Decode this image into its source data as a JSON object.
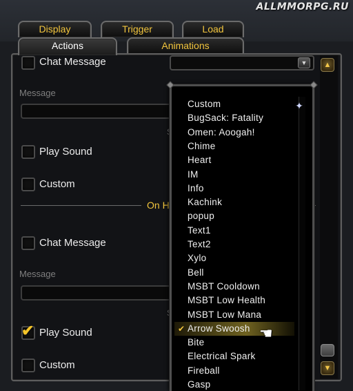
{
  "watermark": "ALLMMORPG.RU",
  "tabs": {
    "display": "Display",
    "trigger": "Trigger",
    "load": "Load",
    "actions": "Actions",
    "animations": "Animations"
  },
  "section1": {
    "chat_message": "Chat Message",
    "message_label": "Message",
    "message_value": "",
    "play_sound": "Play Sound",
    "custom": "Custom",
    "hint": "S"
  },
  "divider_title": "On H",
  "section2": {
    "chat_message": "Chat Message",
    "message_label": "Message",
    "message_value": "",
    "play_sound": "Play Sound",
    "play_sound_checked": true,
    "custom": "Custom",
    "hint": "S"
  },
  "sound_dropdown": {
    "selected": "Arrow Swoosh",
    "items": [
      "Custom",
      "BugSack: Fatality",
      "Omen: Aoogah!",
      "Chime",
      "Heart",
      "IM",
      "Info",
      "Kachink",
      "popup",
      "Text1",
      "Text2",
      "Xylo",
      "Bell",
      "MSBT Cooldown",
      "MSBT Low Health",
      "MSBT Low Mana",
      "Arrow Swoosh",
      "Bite",
      "Electrical Spark",
      "Fireball",
      "Gasp"
    ]
  },
  "icons": {
    "check": "✔",
    "dropdown_arrow": "▼",
    "scroll_up": "▲",
    "scroll_down": "▼",
    "cursor": "hand-pointer-icon"
  },
  "colors": {
    "accent_gold": "#f2c53d",
    "selection": "#aa9632"
  }
}
